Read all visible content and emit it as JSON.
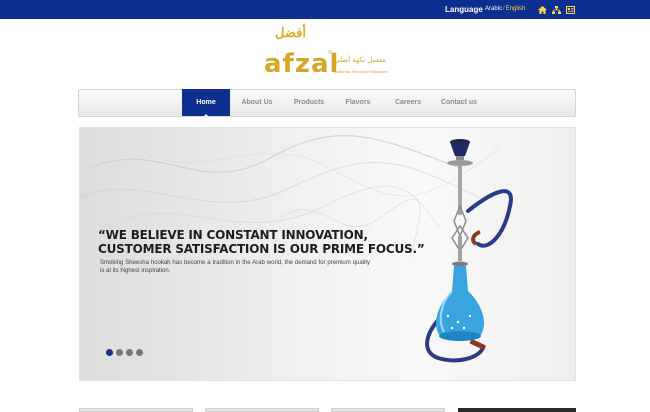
{
  "topbar": {
    "language_label": "Language",
    "lang_arabic": "Arabic",
    "lang_sep": "/",
    "lang_english": "English",
    "icons": [
      "home-icon",
      "sitemap-icon",
      "contact-icon"
    ]
  },
  "logo": {
    "arabic_mark": "أفضل",
    "word": "afzal",
    "tm": "®",
    "arabic_line": "معسل نكهة أصلي",
    "tagline": "Authentic Flavoured Molasses"
  },
  "nav": {
    "items": [
      {
        "label": "Home",
        "active": true
      },
      {
        "label": "About Us",
        "active": false
      },
      {
        "label": "Products",
        "active": false
      },
      {
        "label": "Flavors",
        "active": false
      },
      {
        "label": "Careers",
        "active": false
      },
      {
        "label": "Contact us",
        "active": false
      }
    ]
  },
  "hero": {
    "quote_line1": "“WE BELIEVE IN CONSTANT INNOVATION,",
    "quote_line2": "CUSTOMER SATISFACTION IS OUR PRIME FOCUS.”",
    "description": "Smoking Sheesha hookah has become a tradition in the Arab world, the demand for premium quality is at its highest inspiration.",
    "slides": 4,
    "active_slide": 1
  },
  "colors": {
    "brand_blue": "#0d2f8f",
    "logo_gold": "#d4a62a",
    "active_dot": "#1c2f86",
    "inactive_dot": "#777777"
  }
}
